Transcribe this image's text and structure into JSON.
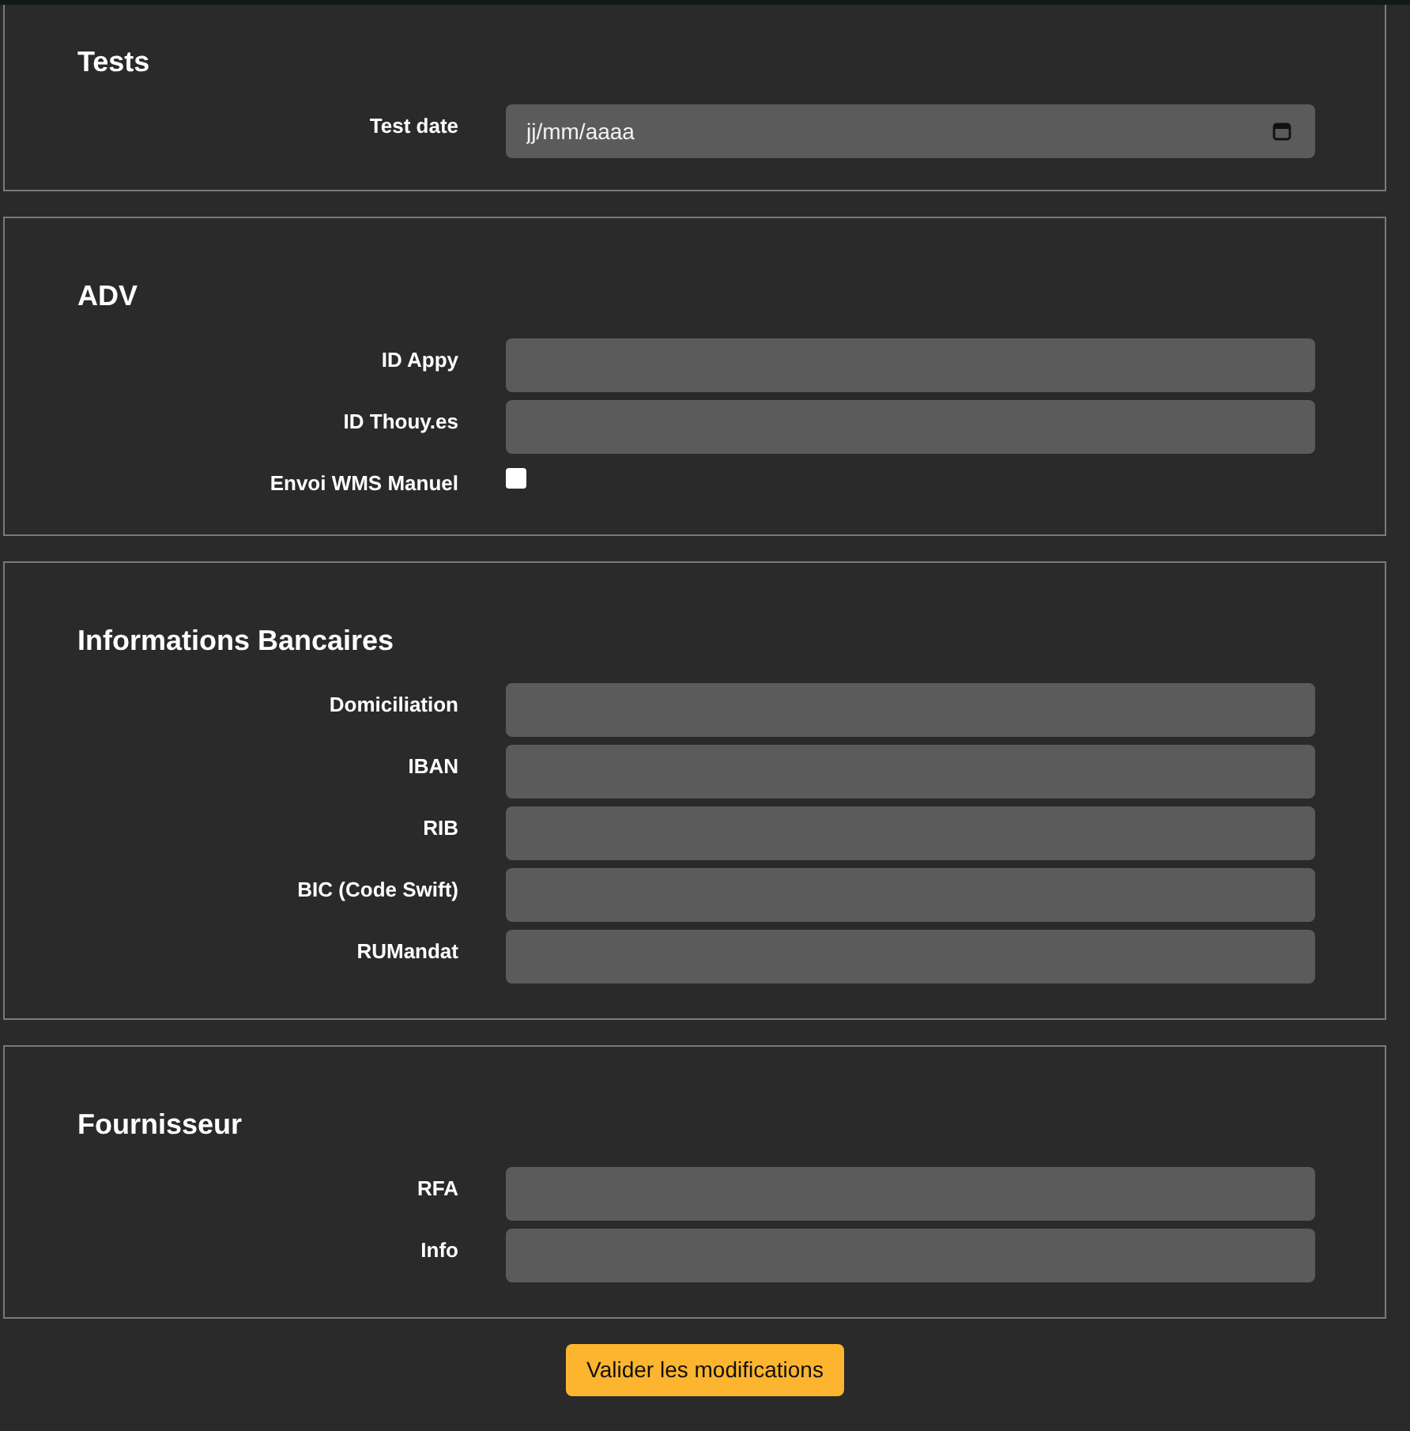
{
  "sections": [
    {
      "title": "Tests",
      "fields": [
        {
          "kind": "date",
          "label": "Test date",
          "placeholder": "jj/mm/aaaa"
        }
      ]
    },
    {
      "title": "ADV",
      "fields": [
        {
          "kind": "text",
          "label": "ID Appy"
        },
        {
          "kind": "text",
          "label": "ID Thouy.es"
        },
        {
          "kind": "checkbox",
          "label": "Envoi WMS Manuel",
          "checked": false
        }
      ]
    },
    {
      "title": "Informations Bancaires",
      "fields": [
        {
          "kind": "text",
          "label": "Domiciliation"
        },
        {
          "kind": "text",
          "label": "IBAN"
        },
        {
          "kind": "text",
          "label": "RIB"
        },
        {
          "kind": "text",
          "label": "BIC (Code Swift)"
        },
        {
          "kind": "text",
          "label": "RUMandat"
        }
      ]
    },
    {
      "title": "Fournisseur",
      "fields": [
        {
          "kind": "text",
          "label": "RFA"
        },
        {
          "kind": "text",
          "label": "Info"
        }
      ]
    }
  ],
  "submit": {
    "label": "Valider les modifications"
  }
}
